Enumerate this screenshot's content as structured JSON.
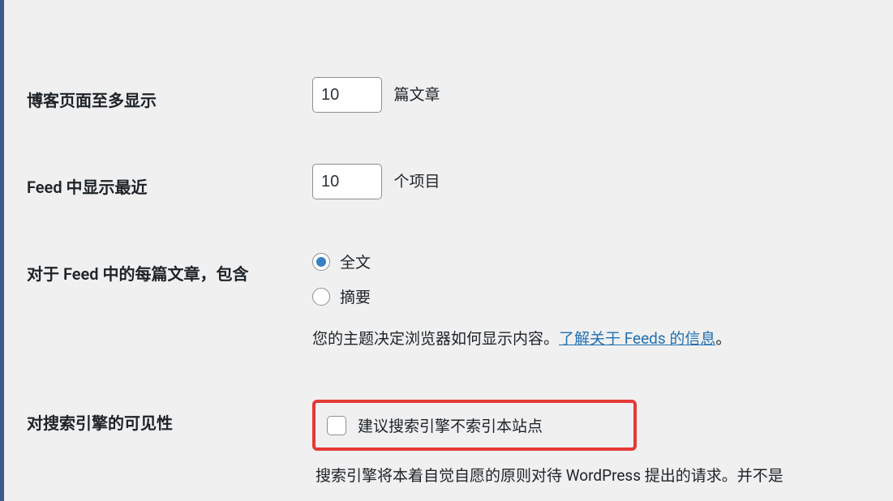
{
  "settings": {
    "posts_per_page": {
      "label": "博客页面至多显示",
      "value": "10",
      "suffix": "篇文章"
    },
    "posts_per_rss": {
      "label": "Feed 中显示最近",
      "value": "10",
      "suffix": "个项目"
    },
    "rss_use_excerpt": {
      "label": "对于 Feed 中的每篇文章，包含",
      "options": {
        "full": "全文",
        "summary": "摘要"
      },
      "description_prefix": "您的主题决定浏览器如何显示内容。",
      "link_text": "了解关于 Feeds 的信息",
      "description_suffix": "。"
    },
    "search_visibility": {
      "label": "对搜索引擎的可见性",
      "checkbox_label": "建议搜索引擎不索引本站点",
      "description": "搜索引擎将本着自觉自愿的原则对待 WordPress 提出的请求。并不是"
    }
  }
}
